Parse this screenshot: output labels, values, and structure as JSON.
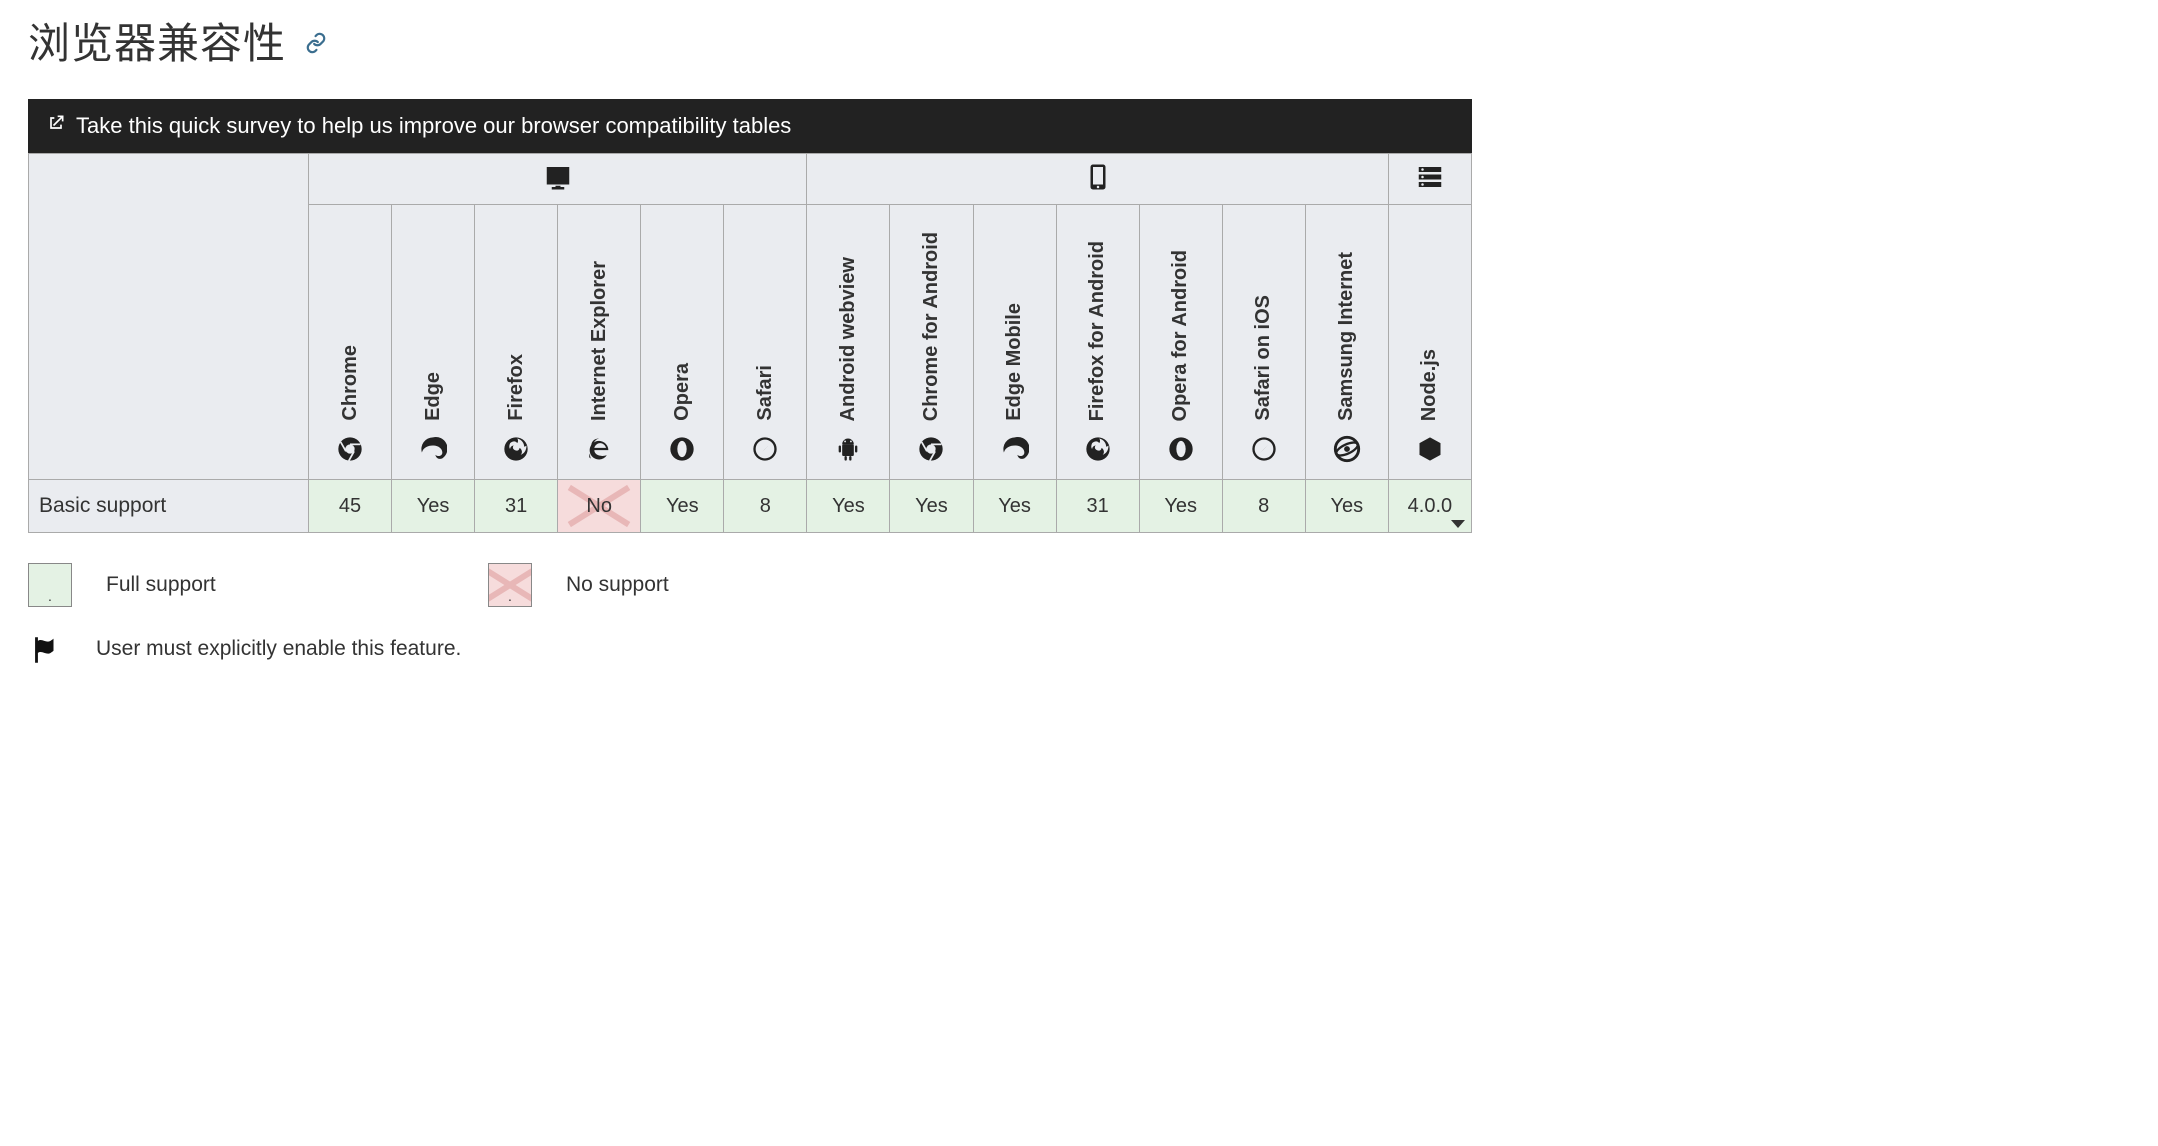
{
  "heading": "浏览器兼容性",
  "survey_text": "Take this quick survey to help us improve our browser compatibility tables",
  "platforms": {
    "desktop": {
      "span": 6,
      "icon": "desktop"
    },
    "mobile": {
      "span": 7,
      "icon": "mobile"
    },
    "server": {
      "span": 1,
      "icon": "server"
    }
  },
  "browsers": [
    {
      "name": "Chrome",
      "icon": "chrome"
    },
    {
      "name": "Edge",
      "icon": "edge"
    },
    {
      "name": "Firefox",
      "icon": "firefox"
    },
    {
      "name": "Internet Explorer",
      "icon": "ie"
    },
    {
      "name": "Opera",
      "icon": "opera"
    },
    {
      "name": "Safari",
      "icon": "safari"
    },
    {
      "name": "Android webview",
      "icon": "android"
    },
    {
      "name": "Chrome for Android",
      "icon": "chrome"
    },
    {
      "name": "Edge Mobile",
      "icon": "edge"
    },
    {
      "name": "Firefox for Android",
      "icon": "firefox"
    },
    {
      "name": "Opera for Android",
      "icon": "opera"
    },
    {
      "name": "Safari on iOS",
      "icon": "safari"
    },
    {
      "name": "Samsung Internet",
      "icon": "samsung"
    },
    {
      "name": "Node.js",
      "icon": "node"
    }
  ],
  "row": {
    "feature": "Basic support",
    "cells": [
      {
        "text": "45",
        "state": "yes"
      },
      {
        "text": "Yes",
        "state": "yes"
      },
      {
        "text": "31",
        "state": "yes"
      },
      {
        "text": "No",
        "state": "no"
      },
      {
        "text": "Yes",
        "state": "yes"
      },
      {
        "text": "8",
        "state": "yes"
      },
      {
        "text": "Yes",
        "state": "yes"
      },
      {
        "text": "Yes",
        "state": "yes"
      },
      {
        "text": "Yes",
        "state": "yes"
      },
      {
        "text": "31",
        "state": "yes"
      },
      {
        "text": "Yes",
        "state": "yes"
      },
      {
        "text": "8",
        "state": "yes"
      },
      {
        "text": "Yes",
        "state": "yes"
      },
      {
        "text": "4.0.0",
        "state": "yes",
        "disclosure": true
      }
    ]
  },
  "legend": {
    "full_support": "Full support",
    "no_support": "No support",
    "flag_note": "User must explicitly enable this feature."
  }
}
